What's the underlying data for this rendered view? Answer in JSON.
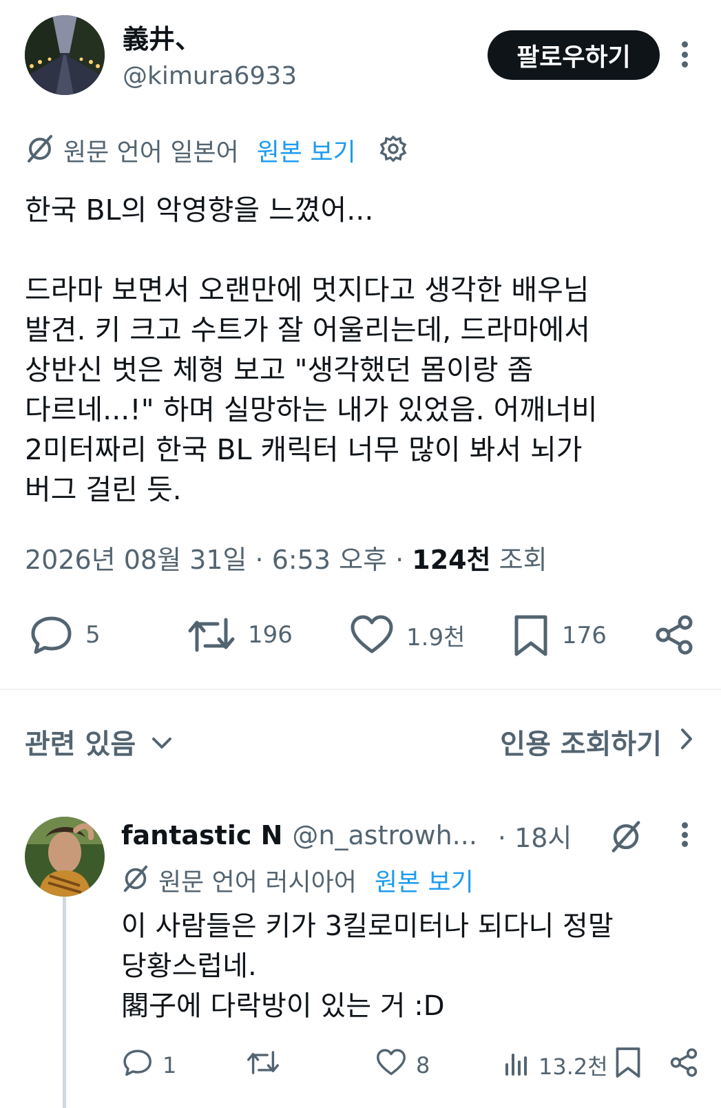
{
  "author": {
    "display_name": "義井、",
    "handle": "@kimura6933",
    "follow_label": "팔로우하기"
  },
  "translation": {
    "label": "원문 언어 일본어",
    "view_original": "원본 보기"
  },
  "tweet": {
    "lines": [
      "한국 BL의 악영향을 느꼈어...",
      "",
      "드라마 보면서 오랜만에 멋지다고 생각한 배우님",
      "발견. 키 크고 수트가 잘 어울리는데, 드라마에서",
      "상반신 벗은 체형 보고 \"생각했던 몸이랑 좀",
      "다르네...!\" 하며 실망하는 내가 있었음. 어깨너비",
      "2미터짜리 한국 BL 캐릭터 너무 많이 봐서 뇌가",
      "버그 걸린 듯."
    ]
  },
  "meta": {
    "timestamp": "2026년 08월 31일 · 6:53 오후 · ",
    "views_count": "124천",
    "views_label": " 조회"
  },
  "actions": {
    "replies": "5",
    "retweets": "196",
    "likes": "1.9천",
    "bookmarks": "176"
  },
  "related": {
    "label": "관련 있음",
    "quotes_label": "인용 조회하기"
  },
  "reply": {
    "display_name": "fantastic N",
    "handle": "@n_astrowh...",
    "time": "· 18시",
    "translation_label": "원문 언어 러시아어",
    "view_original": "원본 보기",
    "lines": [
      "이 사람들은 키가 3킬로미터나 되다니 정말",
      "당황스럽네.",
      "閣子에 다락방이 있는 거 :D"
    ],
    "replies": "1",
    "retweets": "",
    "likes": "8",
    "views": "13.2천"
  },
  "colors": {
    "text": "#0f1419",
    "muted": "#536471",
    "link": "#1d9bf0",
    "divider": "#eff3f4"
  }
}
